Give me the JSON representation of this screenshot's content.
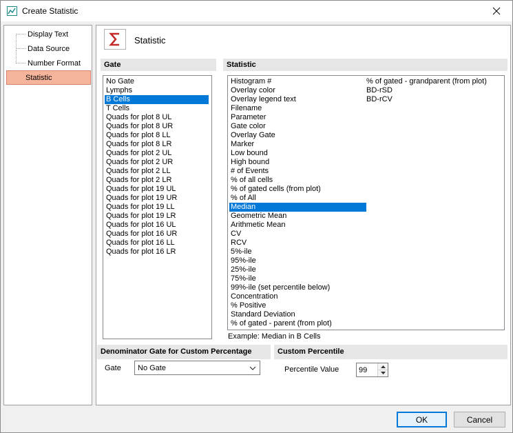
{
  "window": {
    "title": "Create Statistic",
    "close_icon": "close-icon"
  },
  "nav": {
    "items": [
      {
        "label": "Display Text"
      },
      {
        "label": "Data Source"
      },
      {
        "label": "Number Format"
      },
      {
        "label": "Statistic",
        "selected": true
      }
    ]
  },
  "header": {
    "title": "Statistic",
    "icon": "sigma-icon",
    "accent": "#c62828"
  },
  "gate": {
    "title": "Gate",
    "items": [
      "No Gate",
      "Lymphs",
      "B Cells",
      "T Cells",
      "Quads for plot 8 UL",
      "Quads for plot 8 UR",
      "Quads for plot 8 LL",
      "Quads for plot 8 LR",
      "Quads for plot 2 UL",
      "Quads for plot 2 UR",
      "Quads for plot 2 LL",
      "Quads for plot 2 LR",
      "Quads for plot 19 UL",
      "Quads for plot 19 UR",
      "Quads for plot 19 LL",
      "Quads for plot 19 LR",
      "Quads for plot 16 UL",
      "Quads for plot 16 UR",
      "Quads for plot 16 LL",
      "Quads for plot 16 LR"
    ],
    "selected": "B Cells"
  },
  "statistic": {
    "title": "Statistic",
    "col1": [
      "Histogram #",
      "Overlay color",
      "Overlay legend text",
      "Filename",
      "Parameter",
      "Gate color",
      "Overlay Gate",
      "Marker",
      "Low bound",
      "High bound",
      "# of Events",
      "% of all cells",
      "% of gated cells (from plot)",
      "% of All",
      "Median",
      "Geometric Mean",
      "Arithmetic Mean",
      "CV",
      "RCV",
      "5%-ile",
      "95%-ile",
      "25%-ile",
      "75%-ile",
      "99%-ile (set percentile below)",
      "Concentration",
      "% Positive",
      "Standard Deviation",
      "% of gated - parent (from plot)"
    ],
    "col2": [
      "% of gated - grandparent (from plot)",
      "BD-rSD",
      "BD-rCV"
    ],
    "selected": "Median",
    "example": "Example: Median in B Cells"
  },
  "denominator": {
    "title": "Denominator Gate for Custom Percentage",
    "gate_label": "Gate",
    "gate_value": "No Gate"
  },
  "percentile": {
    "title": "Custom Percentile",
    "label": "Percentile Value",
    "value": "99"
  },
  "buttons": {
    "ok": "OK",
    "cancel": "Cancel"
  },
  "colors": {
    "selection": "#0078d7",
    "nav_selected": "#f6b49c"
  }
}
